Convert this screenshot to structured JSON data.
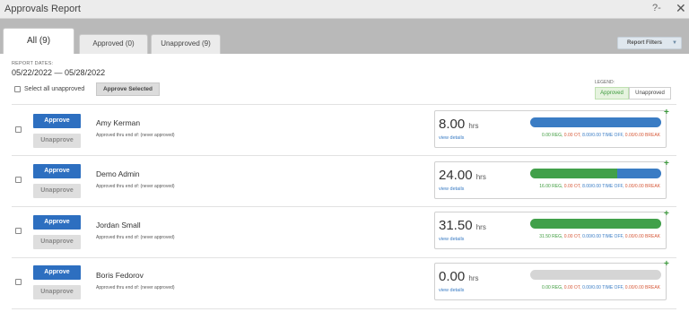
{
  "window": {
    "title": "Approvals Report",
    "help_icon": "?-",
    "close_icon": "✕"
  },
  "tabs": [
    {
      "label": "All (9)",
      "active": true
    },
    {
      "label": "Approved (0)",
      "active": false
    },
    {
      "label": "Unapproved (9)",
      "active": false
    }
  ],
  "report_filters": {
    "label": "Report Filters",
    "caret": "▼"
  },
  "report_dates": {
    "label": "REPORT DATES:",
    "value": "05/22/2022 — 05/28/2022"
  },
  "select_all": {
    "label": "Select all unapproved",
    "checked": false
  },
  "approve_selected_label": "Approve Selected",
  "legend": {
    "title": "LEGEND:",
    "approved": "Approved",
    "unapproved": "Unapproved"
  },
  "colors": {
    "approve_blue": "#2d6fc0",
    "reg_green": "#41a04a",
    "timeoff_blue": "#3a7cc4",
    "empty_grey": "#d5d5d5"
  },
  "employees": [
    {
      "name": "Amy Kerman",
      "subtitle": "Approved thru end of: (never approved)",
      "hours": "8.00",
      "unit": "hrs",
      "view_details": "view details",
      "approve": "Approve",
      "unapprove": "Unapprove",
      "reg": "0.00 REG,",
      "ot": "0.00 OT,",
      "timeoff": "8.00/0.00 TIME OFF,",
      "break": "0.00/0.00 BREAK",
      "reg_fraction": 0.0,
      "timeoff_fraction": 1.0
    },
    {
      "name": "Demo Admin",
      "subtitle": "Approved thru end of: (never approved)",
      "hours": "24.00",
      "unit": "hrs",
      "view_details": "view details",
      "approve": "Approve",
      "unapprove": "Unapprove",
      "reg": "16.00 REG,",
      "ot": "0.00 OT,",
      "timeoff": "8.00/0.00 TIME OFF,",
      "break": "0.00/0.00 BREAK",
      "reg_fraction": 0.667,
      "timeoff_fraction": 0.333
    },
    {
      "name": "Jordan Small",
      "subtitle": "Approved thru end of: (never approved)",
      "hours": "31.50",
      "unit": "hrs",
      "view_details": "view details",
      "approve": "Approve",
      "unapprove": "Unapprove",
      "reg": "31.50 REG,",
      "ot": "0.00 OT,",
      "timeoff": "0.00/0.00 TIME OFF,",
      "break": "0.00/0.00 BREAK",
      "reg_fraction": 1.0,
      "timeoff_fraction": 0.0
    },
    {
      "name": "Boris Fedorov",
      "subtitle": "Approved thru end of: (never approved)",
      "hours": "0.00",
      "unit": "hrs",
      "view_details": "view details",
      "approve": "Approve",
      "unapprove": "Unapprove",
      "reg": "0.00 REG,",
      "ot": "0.00 OT,",
      "timeoff": "0.00/0.00 TIME OFF,",
      "break": "0.00/0.00 BREAK",
      "reg_fraction": 0.0,
      "timeoff_fraction": 0.0
    }
  ]
}
